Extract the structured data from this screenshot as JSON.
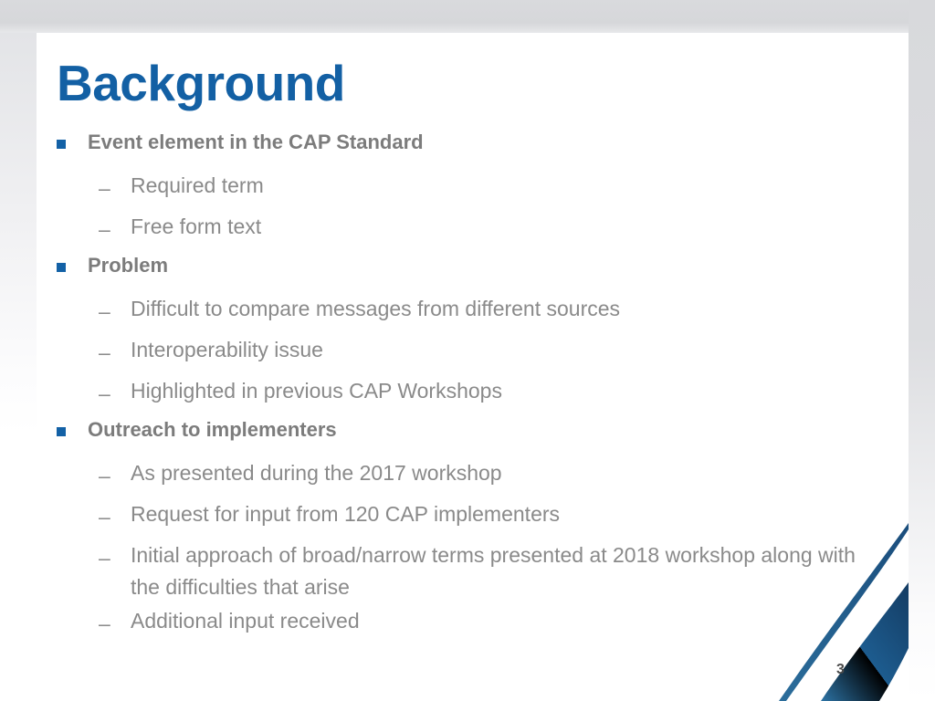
{
  "slide": {
    "title": "Background",
    "page_number": "3",
    "colors": {
      "title_blue": "#1360a4",
      "bullet_square_blue": "#1361a6",
      "level1_text_gray": "#7c7c7c",
      "level2_text_gray": "#8a8a8a",
      "swoosh_dark_blue": "#1b4f7e",
      "swoosh_light_blue": "#2e6f9e",
      "surround_gray": "#d8d9dc"
    },
    "markers": {
      "level1": "▪",
      "level2": "–"
    },
    "bullets": [
      {
        "level": 1,
        "text": "Event element in the CAP Standard"
      },
      {
        "level": 2,
        "text": "Required term"
      },
      {
        "level": 2,
        "text": "Free form text"
      },
      {
        "level": 1,
        "text": "Problem"
      },
      {
        "level": 2,
        "text": "Difficult to compare messages from different sources"
      },
      {
        "level": 2,
        "text": "Interoperability issue"
      },
      {
        "level": 2,
        "text": "Highlighted in previous CAP Workshops"
      },
      {
        "level": 1,
        "text": "Outreach to implementers"
      },
      {
        "level": 2,
        "text": "As presented during the 2017 workshop"
      },
      {
        "level": 2,
        "text": "Request for input from 120 CAP implementers"
      },
      {
        "level": 2,
        "text": "Initial approach of broad/narrow terms presented at 2018 workshop along with the difficulties that arise"
      },
      {
        "level": 2,
        "text": "Additional input received"
      }
    ]
  }
}
